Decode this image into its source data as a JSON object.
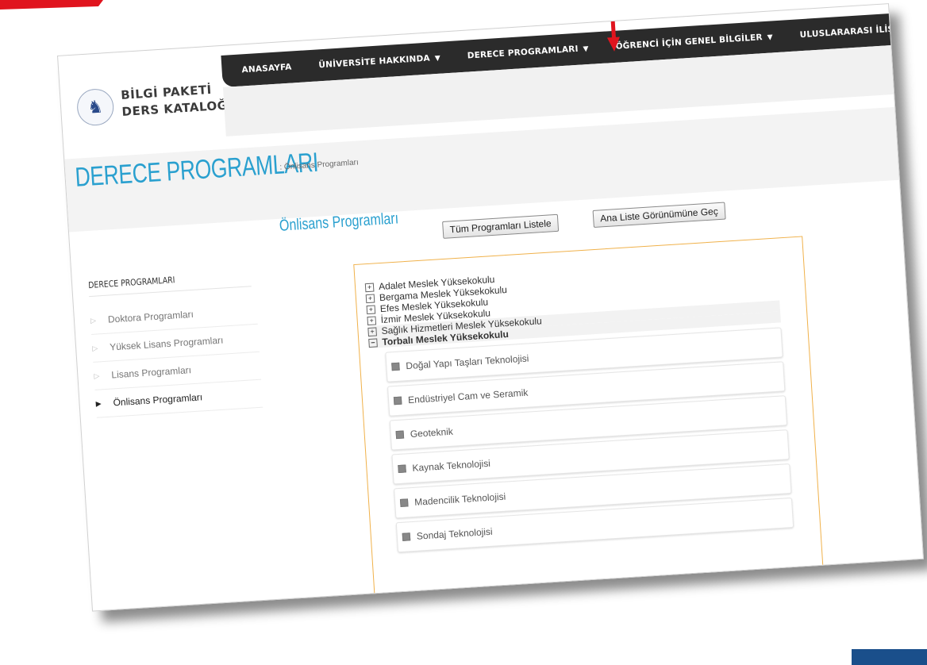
{
  "logo": {
    "line1": "BİLGİ PAKETİ",
    "line2": "DERS KATALOĞU"
  },
  "nav": {
    "items": [
      {
        "label": "ANASAYFA",
        "dropdown": false
      },
      {
        "label": "ÜNİVERSİTE HAKKINDA",
        "dropdown": true
      },
      {
        "label": "DERECE PROGRAMLARI",
        "dropdown": true
      },
      {
        "label": "ÖĞRENCİ İÇİN GENEL BİLGİLER",
        "dropdown": true
      },
      {
        "label": "ULUSLARARASI İLİŞKİLER",
        "dropdown": true
      }
    ]
  },
  "page": {
    "title": "DERECE PROGRAMLARI",
    "breadcrumb": ": Önlisans Programları"
  },
  "sidebar": {
    "heading": "DERECE PROGRAMLARI",
    "items": [
      {
        "label": "Doktora Programları",
        "active": false
      },
      {
        "label": "Yüksek Lisans Programları",
        "active": false
      },
      {
        "label": "Lisans Programları",
        "active": false
      },
      {
        "label": "Önlisans Programları",
        "active": true
      }
    ]
  },
  "main": {
    "title": "Önlisans Programları",
    "list_all_button": "Tüm Programları Listele",
    "main_view_button": "Ana Liste Görünümüne Geç",
    "tree": [
      {
        "label": "Adalet Meslek Yüksekokulu",
        "expanded": false
      },
      {
        "label": "Bergama Meslek Yüksekokulu",
        "expanded": false
      },
      {
        "label": "Efes Meslek Yüksekokulu",
        "expanded": false
      },
      {
        "label": "İzmir Meslek Yüksekokulu",
        "expanded": false
      },
      {
        "label": "Sağlık Hizmetleri Meslek Yüksekokulu",
        "expanded": false
      },
      {
        "label": "Torbalı Meslek Yüksekokulu",
        "expanded": true
      }
    ],
    "sub_programs": [
      "Doğal Yapı Taşları Teknolojisi",
      "Endüstriyel Cam ve Seramik",
      "Geoteknik",
      "Kaynak Teknolojisi",
      "Madencilik Teknolojisi",
      "Sondaj Teknolojisi"
    ]
  },
  "colors": {
    "accent": "#2aa0cf",
    "navbar": "#2b2b2b",
    "tree_border": "#f0b14a",
    "annotation_red": "#e0141e",
    "corner_blue": "#1a4f8b"
  },
  "icons": {
    "caret": "caret-down-icon",
    "expand": "plus-square-icon",
    "collapse": "minus-square-icon",
    "bullet": "square-bullet-icon",
    "arrow": "triangle-right-icon"
  }
}
